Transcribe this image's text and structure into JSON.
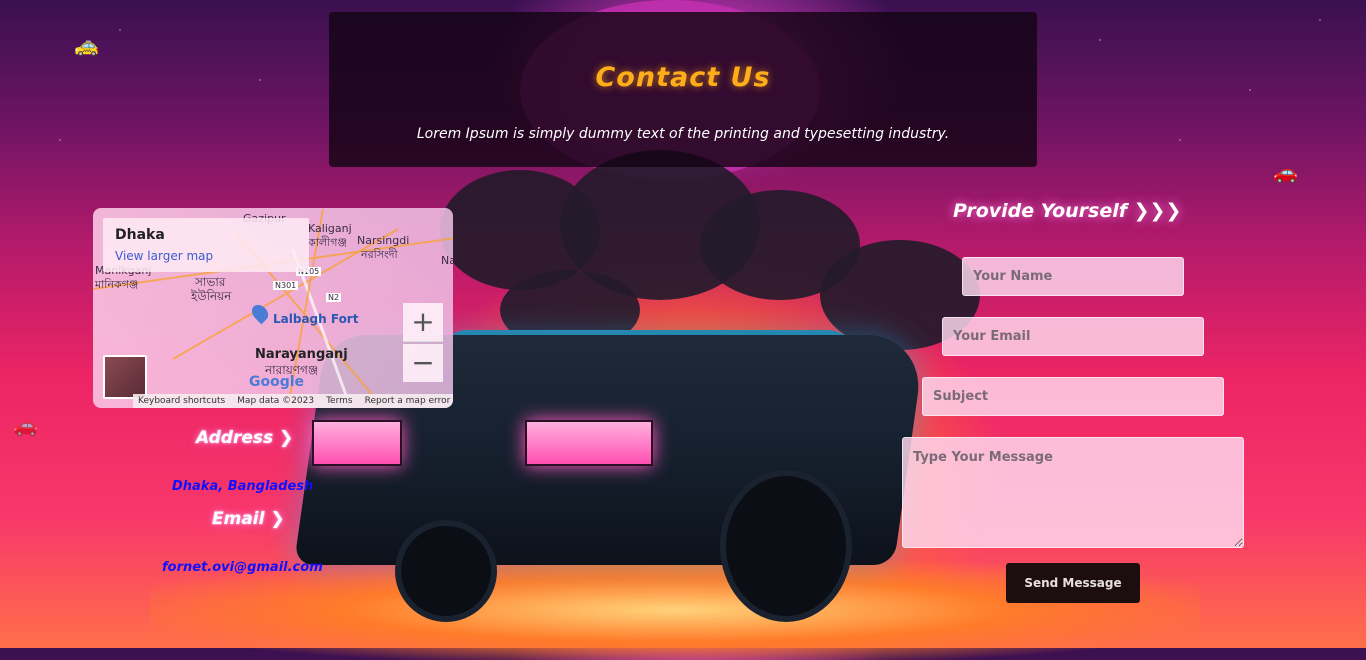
{
  "header": {
    "title": "Contact Us",
    "subtitle": "Lorem Ipsum is simply dummy text of the printing and typesetting industry."
  },
  "map": {
    "place_name": "Dhaka",
    "larger_map_link": "View larger map",
    "labels": [
      "Gazipur",
      "Kaliganj",
      "কালীগঞ্জ",
      "Narsingdi",
      "নরসিংদী",
      "Manikganj",
      "মানিকগঞ্জ",
      "সাভার",
      "ইউনিয়ন",
      "Lalbagh Fort",
      "Narayanganj",
      "নারায়ণগঞ্জ",
      "N105",
      "N301",
      "N2",
      "Na"
    ],
    "zoom_in": "+",
    "zoom_out": "−",
    "footer": [
      "Keyboard shortcuts",
      "Map data ©2023",
      "Terms",
      "Report a map error"
    ],
    "logo": "Google"
  },
  "contact_info": {
    "address_heading": "Address ❯",
    "address_value": "Dhaka, Bangladesh",
    "email_heading": "Email ❯",
    "email_value": "fornet.ovi@gmail.com"
  },
  "form": {
    "title": "Provide Yourself ❯❯❯",
    "name_placeholder": "Your Name",
    "email_placeholder": "Your Email",
    "subject_placeholder": "Subject",
    "message_placeholder": "Type Your Message",
    "submit_label": "Send Message"
  },
  "icons": {
    "taxi": "taxi-icon",
    "car": "car-icon"
  },
  "colors": {
    "title": "#ffae1a",
    "link_text": "#1010ff",
    "accent_glow": "#ff79d9"
  }
}
